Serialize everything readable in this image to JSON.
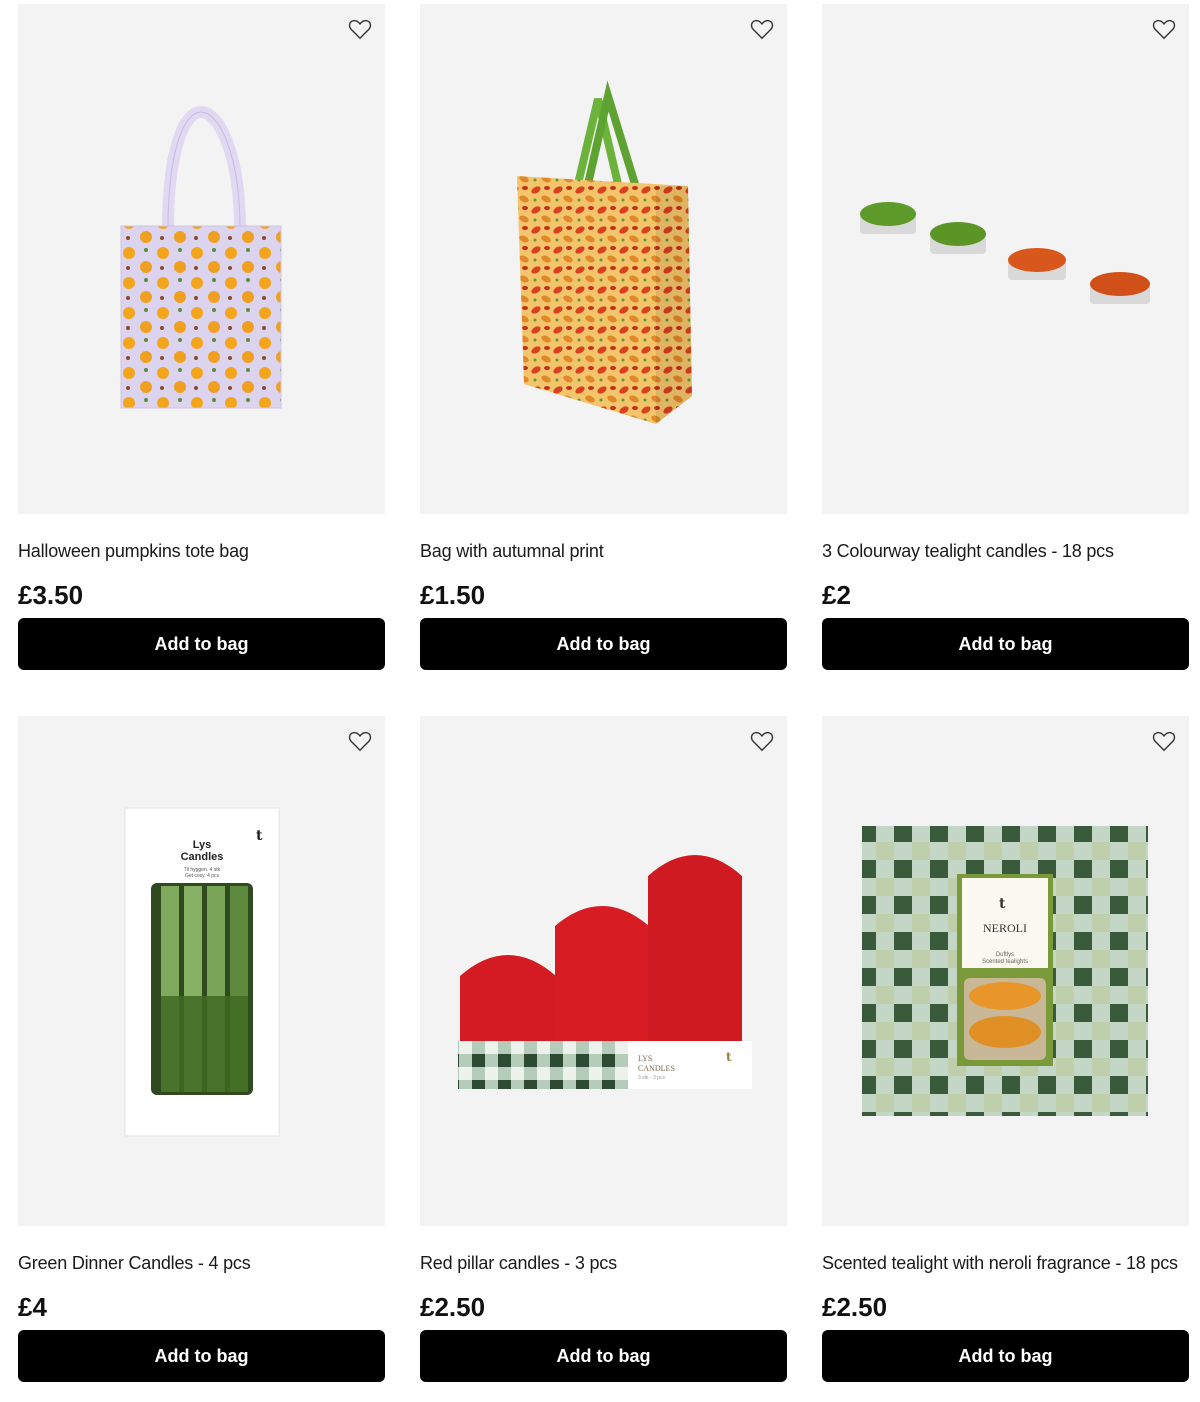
{
  "products": [
    {
      "title": "Halloween pumpkins tote bag",
      "price": "£3.50",
      "cta": "Add to bag",
      "image": "tote-bag-image",
      "favorite_icon": "heart-icon"
    },
    {
      "title": "Bag with autumnal print",
      "price": "£1.50",
      "cta": "Add to bag",
      "image": "gift-bag-image",
      "favorite_icon": "heart-icon"
    },
    {
      "title": "3 Colourway tealight candles - 18 pcs",
      "price": "£2",
      "cta": "Add to bag",
      "image": "tealights-image",
      "favorite_icon": "heart-icon"
    },
    {
      "title": "Green Dinner Candles - 4 pcs",
      "price": "£4",
      "cta": "Add to bag",
      "image": "dinner-candles-image",
      "favorite_icon": "heart-icon",
      "packaging_text": {
        "line1": "Lys",
        "line2": "Candles",
        "line3": "Til hyggen. 4 stk",
        "line4": "Get cosy. 4 pcs"
      }
    },
    {
      "title": "Red pillar candles - 3 pcs",
      "price": "£2.50",
      "cta": "Add to bag",
      "image": "pillar-candles-image",
      "favorite_icon": "heart-icon",
      "packaging_text": {
        "line1": "LYS",
        "line2": "CANDLES",
        "line3": "3 stk - 3 pcs"
      }
    },
    {
      "title": "Scented tealight with neroli fragrance - 18 pcs",
      "price": "£2.50",
      "cta": "Add to bag",
      "image": "neroli-tealights-image",
      "favorite_icon": "heart-icon",
      "packaging_text": {
        "line1": "NEROLI",
        "line2": "Duftlys",
        "line3": "Scented tealights"
      }
    }
  ],
  "colors": {
    "button_bg": "#000000",
    "button_text": "#ffffff",
    "image_bg": "#f3f3f3"
  }
}
